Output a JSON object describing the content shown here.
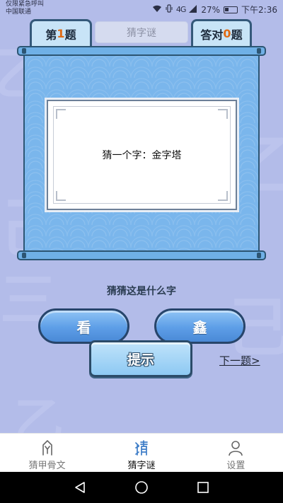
{
  "status_bar": {
    "carrier_line1": "仅限紧急呼叫",
    "carrier_line2": "中国联通",
    "network": "4G",
    "battery": "27%",
    "time": "下午2:36"
  },
  "header": {
    "level_prefix": "第",
    "level_number": "1",
    "level_suffix": "题",
    "title": "猜字谜",
    "correct_prefix": "答对",
    "correct_number": "0",
    "correct_suffix": "题"
  },
  "riddle": {
    "text": "猜一个字：金字塔"
  },
  "question": "猜猜这是什么字",
  "answers": [
    "看",
    "鑫"
  ],
  "hint_label": "提示",
  "next_label": "下一题>",
  "bottom_nav": {
    "items": [
      {
        "label": "猜甲骨文",
        "icon": "oracle-bone-icon"
      },
      {
        "label": "猜字谜",
        "icon": "riddle-icon"
      },
      {
        "label": "设置",
        "icon": "person-icon"
      }
    ],
    "active_index": 1
  },
  "colors": {
    "background": "#b3bce9",
    "scroll": "#7ab6ec",
    "accent_number": "#e06a13",
    "active_nav": "#3c7cc7"
  }
}
